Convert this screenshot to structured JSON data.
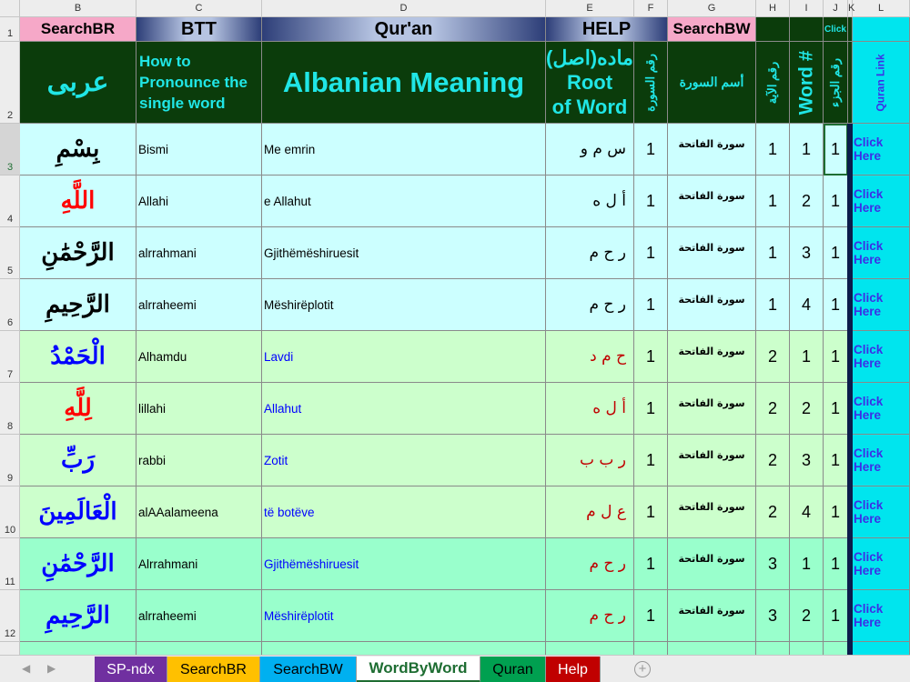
{
  "columns": [
    "B",
    "C",
    "D",
    "E",
    "F",
    "G",
    "H",
    "I",
    "J",
    "K",
    "L"
  ],
  "row_numbers": [
    "1",
    "2",
    "3",
    "4",
    "5",
    "6",
    "7",
    "8",
    "9",
    "10",
    "11",
    "12"
  ],
  "row1": {
    "b": "SearchBR",
    "c": "BTT",
    "d": "Qur'an",
    "e": "HELP",
    "g": "SearchBW",
    "j": "Click"
  },
  "row2": {
    "b": "عربی",
    "c": "How to Pronounce the single word",
    "d": "Albanian Meaning",
    "e_top": "ماده(اصل)",
    "e_mid": "Root",
    "e_bot": "of Word",
    "f": "رقم السورة",
    "g": "أسم السورة",
    "h": "رقم الآية",
    "i": "Word #",
    "j": "رقم الجزء",
    "l": "Quran Link"
  },
  "rows": [
    {
      "arabic": "بِسْمِ",
      "pron": "Bismi",
      "meaning": "Me emrin",
      "root": "س م و",
      "surah_no": "1",
      "surah": "سورة الفاتحة",
      "ayah": "1",
      "word": "1",
      "juz": "1",
      "link": "Click Here"
    },
    {
      "arabic": "اللَّهِ",
      "pron": "Allahi",
      "meaning": "e Allahut",
      "root": "أ ل ه",
      "surah_no": "1",
      "surah": "سورة الفاتحة",
      "ayah": "1",
      "word": "2",
      "juz": "1",
      "link": "Click Here"
    },
    {
      "arabic": "الرَّحْمَٰنِ",
      "pron": "alrrahmani",
      "meaning": "Gjithëmëshiruesit",
      "root": "ر ح م",
      "surah_no": "1",
      "surah": "سورة الفاتحة",
      "ayah": "1",
      "word": "3",
      "juz": "1",
      "link": "Click Here"
    },
    {
      "arabic": "الرَّحِيمِ",
      "pron": "alrraheemi",
      "meaning": "Mëshirëplotit",
      "root": "ر ح م",
      "surah_no": "1",
      "surah": "سورة الفاتحة",
      "ayah": "1",
      "word": "4",
      "juz": "1",
      "link": "Click Here"
    },
    {
      "arabic": "الْحَمْدُ",
      "pron": "Alhamdu",
      "meaning": "Lavdi",
      "root": "ح م د",
      "surah_no": "1",
      "surah": "سورة الفاتحة",
      "ayah": "2",
      "word": "1",
      "juz": "1",
      "link": "Click Here"
    },
    {
      "arabic": "لِلَّهِ",
      "pron": "lillahi",
      "meaning": "Allahut",
      "root": "أ ل ه",
      "surah_no": "1",
      "surah": "سورة الفاتحة",
      "ayah": "2",
      "word": "2",
      "juz": "1",
      "link": "Click Here"
    },
    {
      "arabic": "رَبِّ",
      "pron": "rabbi",
      "meaning": "Zotit",
      "root": "ر ب ب",
      "surah_no": "1",
      "surah": "سورة الفاتحة",
      "ayah": "2",
      "word": "3",
      "juz": "1",
      "link": "Click Here"
    },
    {
      "arabic": "الْعَالَمِينَ",
      "pron": "alAAalameena",
      "meaning": "të botëve",
      "root": "ع ل م",
      "surah_no": "1",
      "surah": "سورة الفاتحة",
      "ayah": "2",
      "word": "4",
      "juz": "1",
      "link": "Click Here"
    },
    {
      "arabic": "الرَّحْمَٰنِ",
      "pron": "Alrrahmani",
      "meaning": "Gjithëmëshiruesit",
      "root": "ر ح م",
      "surah_no": "1",
      "surah": "سورة الفاتحة",
      "ayah": "3",
      "word": "1",
      "juz": "1",
      "link": "Click Here"
    },
    {
      "arabic": "الرَّحِيمِ",
      "pron": "alrraheemi",
      "meaning": "Mëshirëplotit",
      "root": "ر ح م",
      "surah_no": "1",
      "surah": "سورة الفاتحة",
      "ayah": "3",
      "word": "2",
      "juz": "1",
      "link": "Click Here"
    }
  ],
  "row_styles": [
    {
      "bg": "#ccffff",
      "arabic_color": "#000000",
      "meaning_color": "#000000",
      "root_color": "#000000"
    },
    {
      "bg": "#ccffff",
      "arabic_color": "#ff0000",
      "meaning_color": "#000000",
      "root_color": "#000000"
    },
    {
      "bg": "#ccffff",
      "arabic_color": "#000000",
      "meaning_color": "#000000",
      "root_color": "#000000"
    },
    {
      "bg": "#ccffff",
      "arabic_color": "#000000",
      "meaning_color": "#000000",
      "root_color": "#000000"
    },
    {
      "bg": "#ccffcc",
      "arabic_color": "#0000ff",
      "meaning_color": "#0000ff",
      "root_color": "#c00000"
    },
    {
      "bg": "#ccffcc",
      "arabic_color": "#ff0000",
      "meaning_color": "#0000ff",
      "root_color": "#c00000"
    },
    {
      "bg": "#ccffcc",
      "arabic_color": "#0000ff",
      "meaning_color": "#0000ff",
      "root_color": "#c00000"
    },
    {
      "bg": "#ccffcc",
      "arabic_color": "#0000ff",
      "meaning_color": "#0000ff",
      "root_color": "#c00000"
    },
    {
      "bg": "#99ffcc",
      "arabic_color": "#0000ff",
      "meaning_color": "#0000ff",
      "root_color": "#c00000"
    },
    {
      "bg": "#99ffcc",
      "arabic_color": "#0000ff",
      "meaning_color": "#0000ff",
      "root_color": "#c00000"
    }
  ],
  "tabs": [
    {
      "label": "SP-ndx",
      "bg": "#7030a0",
      "color": "#ffffff",
      "active": false
    },
    {
      "label": "SearchBR",
      "bg": "#ffc000",
      "color": "#000000",
      "active": false
    },
    {
      "label": "SearchBW",
      "bg": "#00b0f0",
      "color": "#000000",
      "active": false
    },
    {
      "label": "WordByWord",
      "bg": "#ffffff",
      "color": "#1e6d32",
      "active": true
    },
    {
      "label": "Quran",
      "bg": "#00a050",
      "color": "#000000",
      "active": false
    },
    {
      "label": "Help",
      "bg": "#c00000",
      "color": "#ffffff",
      "active": false
    }
  ],
  "icons": {
    "scroll_left": "triangle-left-icon",
    "scroll_right": "triangle-right-icon",
    "add_sheet": "plus-circle-icon"
  }
}
